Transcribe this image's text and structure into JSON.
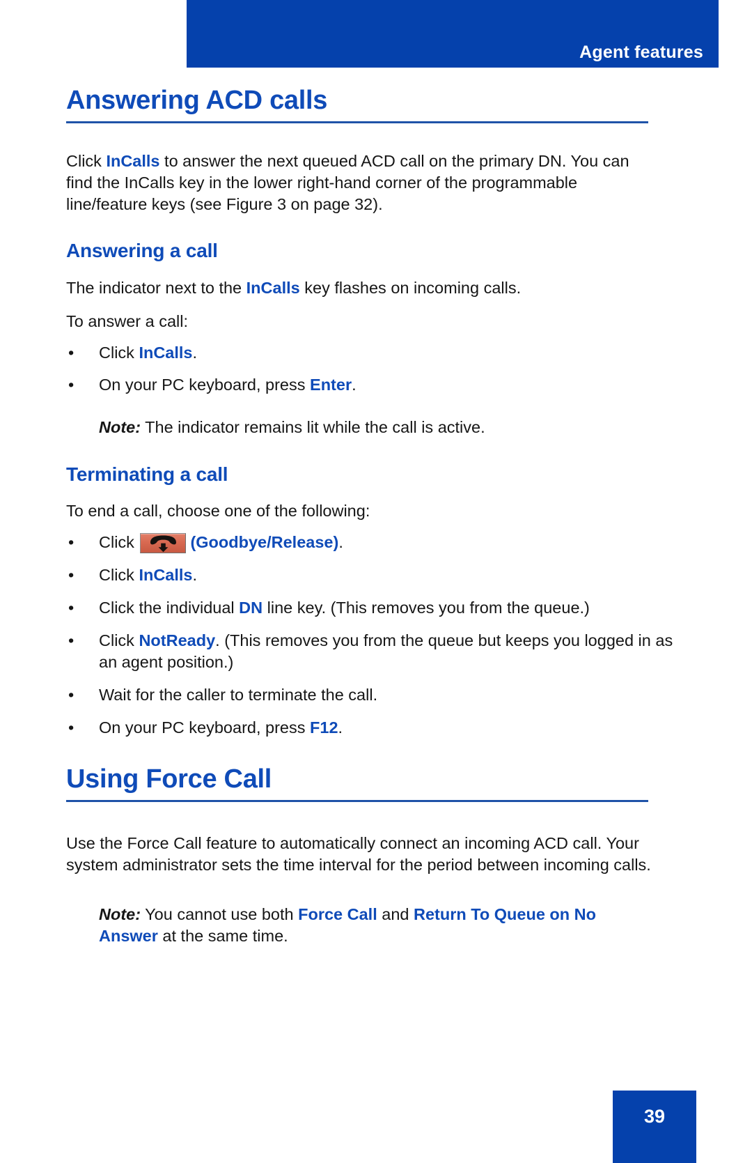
{
  "header": {
    "running_head": "Agent features",
    "band_color": "#0541ac"
  },
  "colors": {
    "heading_blue": "#0f4bb8",
    "keyword_blue": "#0f4bb8",
    "band_blue": "#0541ac",
    "rule_blue": "#1f53a8",
    "key_button_orange": "#d96a52",
    "body_text": "#161616"
  },
  "sections": {
    "answering_acd_calls": {
      "title": "Answering ACD calls",
      "intro": {
        "part1": "Click ",
        "kw1": "InCalls",
        "part2": " to answer the next queued ACD call on the primary DN. You can find the InCalls key in the lower right-hand corner of the programmable line/feature keys (see Figure 3 on page 32)."
      }
    },
    "answering_a_call": {
      "title": "Answering a call",
      "lead": {
        "part1": "The indicator next to the ",
        "kw1": "InCalls",
        "part2": " key flashes on incoming calls."
      },
      "prompt": "To answer a call:",
      "bullets": [
        {
          "bullet": "•",
          "part1": "Click ",
          "kw": "InCalls",
          "part2": "."
        },
        {
          "bullet": "•",
          "part1": "On your PC keyboard, press ",
          "kw": "Enter",
          "part2": "."
        }
      ],
      "note": {
        "label": "Note:",
        "text": " The indicator remains lit while the call is active."
      }
    },
    "terminating_a_call": {
      "title": "Terminating a call",
      "prompt": "To end a call, choose one of the following:",
      "bullets": [
        {
          "bullet": "•",
          "part1": "Click ",
          "icon": "handset-down-arrow-icon",
          "kw": "(Goodbye/Release)",
          "part2": "."
        },
        {
          "bullet": "•",
          "part1": "Click ",
          "kw": "InCalls",
          "part2": "."
        },
        {
          "bullet": "•",
          "part1": "Click the individual ",
          "kw": "DN",
          "part2": " line key. (This removes you from the queue.)"
        },
        {
          "bullet": "•",
          "part1": "Click ",
          "kw": "NotReady",
          "part2": ". (This removes you from the queue but keeps you logged in as an agent position.)"
        },
        {
          "bullet": "•",
          "part1": "Wait for the caller to terminate the call.",
          "kw": "",
          "part2": ""
        },
        {
          "bullet": "•",
          "part1": "On your PC keyboard, press ",
          "kw": "F12",
          "part2": "."
        }
      ]
    },
    "using_force_call": {
      "title": "Using Force Call",
      "body": "Use the Force Call feature to automatically connect an incoming ACD call. Your system administrator sets the time interval for the period between incoming calls.",
      "note": {
        "label": "Note:",
        "part1": " You cannot use both ",
        "kw1": "Force Call",
        "part2": " and ",
        "kw2": "Return To Queue on No Answer",
        "part3": " at the same time."
      }
    }
  },
  "footer": {
    "page_number": "39"
  }
}
